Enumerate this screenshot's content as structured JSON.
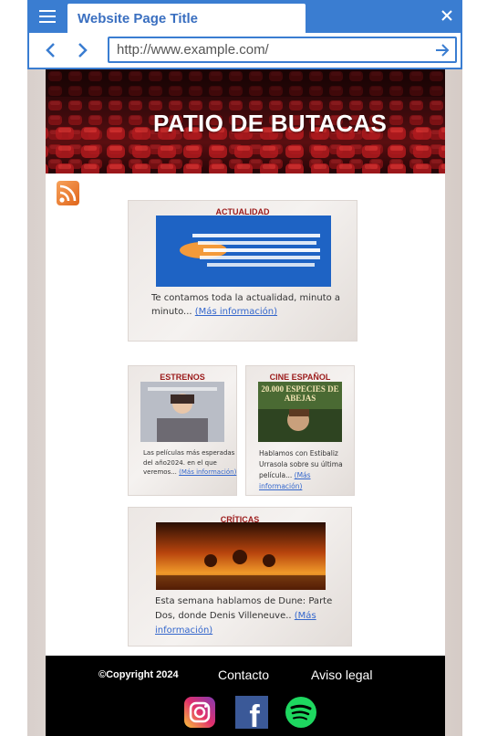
{
  "browser": {
    "tab_title": "Website Page Title",
    "url": "http://www.example.com/"
  },
  "site": {
    "banner_title": "PATIO DE BUTACAS"
  },
  "cards": {
    "actualidad": {
      "title": "ACTUALIDAD",
      "text": "Te contamos toda la actualidad, minuto a minuto... ",
      "more": "(Más información)"
    },
    "estrenos": {
      "title": "ESTRENOS",
      "text": "Las películas más esperadas del año2024. en el que veremos... ",
      "more": "(Más información)"
    },
    "cine_espanol": {
      "title": "CINE ESPAÑOL",
      "poster_title": "20.000 ESPECIES DE ABEJAS",
      "text": "Hablamos con Estibaliz Urrasola sobre su última película... ",
      "more": "(Más información)"
    },
    "criticas": {
      "title": "CRÍTICAS",
      "text": "Esta semana hablamos de Dune: Parte Dos, donde Denis Villeneuve.. ",
      "more": "(Más información)"
    }
  },
  "footer": {
    "copyright": "©Copyright 2024",
    "contact": "Contacto",
    "legal": "Aviso legal"
  },
  "social": {
    "facebook_letter": "f"
  },
  "colors": {
    "browser_accent": "#3a7dd1",
    "card_title": "#9b1a1a",
    "link": "#3366cc",
    "footer_bg": "#000000"
  },
  "icons": [
    "menu-icon",
    "close-icon",
    "back-arrow-icon",
    "forward-arrow-icon",
    "go-arrow-icon",
    "rss-icon",
    "instagram-icon",
    "facebook-icon",
    "spotify-icon"
  ]
}
